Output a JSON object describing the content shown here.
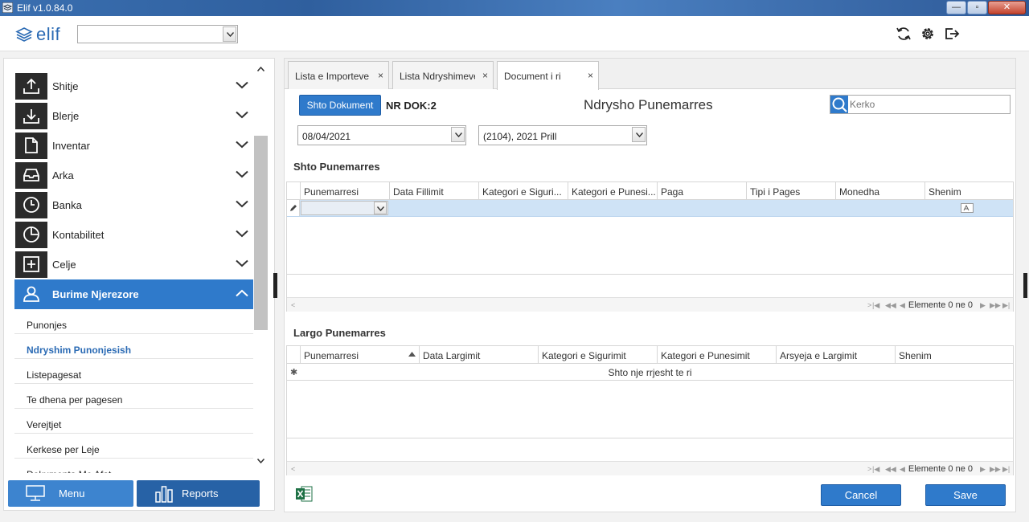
{
  "window": {
    "title": "Elif v1.0.84.0",
    "min_label": "—",
    "max_label": "▫",
    "close_label": "✕"
  },
  "header": {
    "logo_text": "elif",
    "combo_value": ""
  },
  "sidebar": {
    "items": [
      {
        "label": "Shitje",
        "icon": "upload-icon"
      },
      {
        "label": "Blerje",
        "icon": "download-icon"
      },
      {
        "label": "Inventar",
        "icon": "document-icon"
      },
      {
        "label": "Arka",
        "icon": "inbox-icon"
      },
      {
        "label": "Banka",
        "icon": "clock-icon"
      },
      {
        "label": "Kontabilitet",
        "icon": "pie-chart-icon"
      },
      {
        "label": "Celje",
        "icon": "plus-square-icon"
      },
      {
        "label": "Burime Njerezore",
        "icon": "user-icon",
        "active": true
      }
    ],
    "subitems": [
      "Punonjes",
      "Ndryshim Punonjesish",
      "Listepagesat",
      "Te dhena per pagesen",
      "Verejtjet",
      "Kerkese per Leje",
      "Dokumenta Me Afat"
    ],
    "menu_button": "Menu",
    "reports_button": "Reports"
  },
  "tabs": [
    {
      "label": "Lista e Importeve",
      "close": "×"
    },
    {
      "label": "Lista Ndryshimeve",
      "close": "×"
    },
    {
      "label": "Document i ri",
      "close": "×"
    }
  ],
  "toolbar": {
    "add_document": "Shto Dokument",
    "doc_number": "NR DOK:2",
    "page_title": "Ndrysho Punemarres",
    "search_placeholder": "Kerko"
  },
  "filters": {
    "date": "08/04/2021",
    "period": "(2104), 2021 Prill"
  },
  "add_section": {
    "title": "Shto Punemarres",
    "columns": [
      "Punemarresi",
      "Data Fillimit",
      "Kategori e Siguri...",
      "Kategori e Punesi...",
      "Paga",
      "Tipi i Pages",
      "Monedha",
      "Shenim"
    ],
    "pager": "Elemente 0 ne 0"
  },
  "remove_section": {
    "title": "Largo Punemarres",
    "columns": [
      "Punemarresi",
      "Data Largimit",
      "Kategori e Sigurimit",
      "Kategori e Punesimit",
      "Arsyeja e Largimit",
      "Shenim"
    ],
    "new_row_text": "Shto nje rrjesht te ri",
    "pager": "Elemente 0 ne 0"
  },
  "actions": {
    "cancel": "Cancel",
    "save": "Save"
  },
  "colors": {
    "accent": "#2f7acb",
    "active_menu": "#2f7acb",
    "reports_button": "#2762a6",
    "edit_row": "#cfe3f6"
  }
}
